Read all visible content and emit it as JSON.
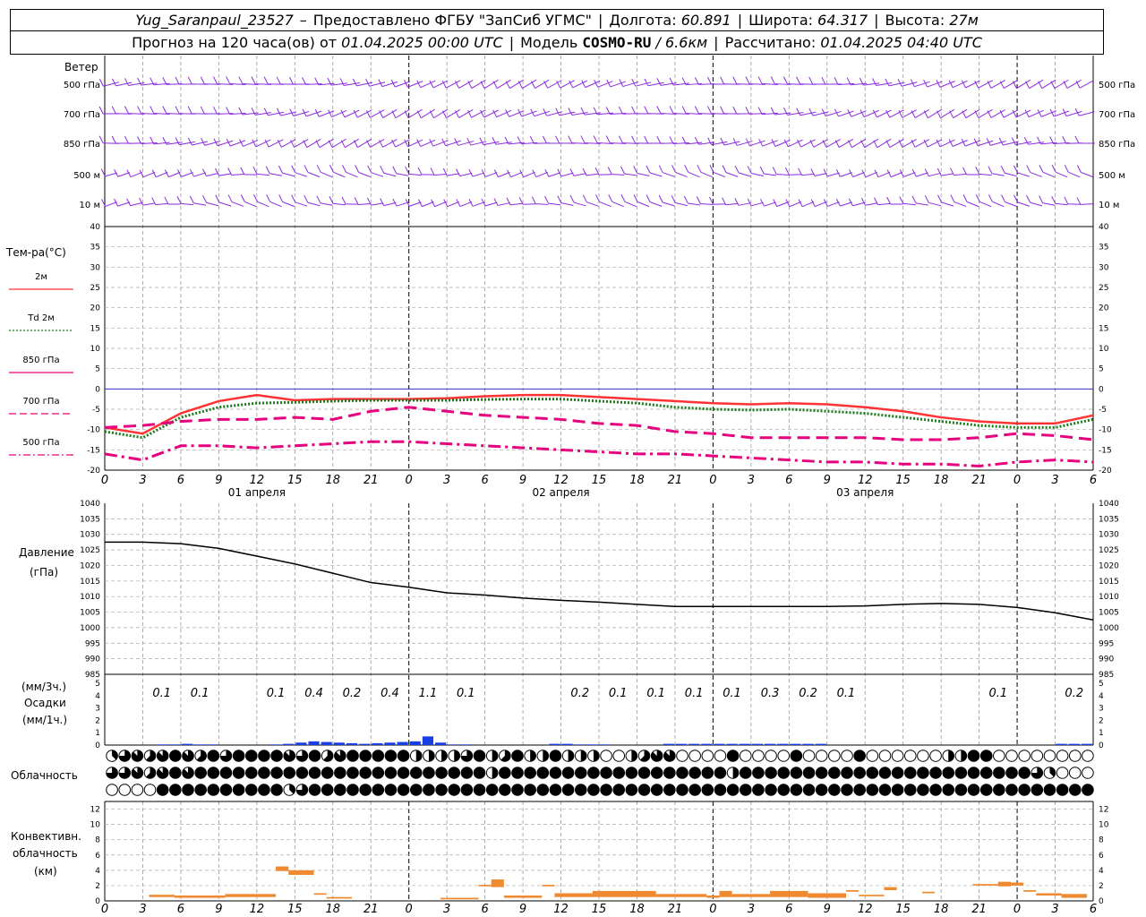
{
  "header": {
    "station": "Yug_Saranpaul_23527",
    "dash": "–",
    "provider": "Предоставлено ФГБУ \"ЗапСиб УГМС\"",
    "lon_label": "Долгота:",
    "lon_value": "60.891",
    "lat_label": "Широта:",
    "lat_value": "64.317",
    "alt_label": "Высота:",
    "alt_value": "27м",
    "forecast_label": "Прогноз на 120 часа(ов) от",
    "forecast_date": "01.04.2025 00:00 UTC",
    "model_label": "Модель",
    "model_name": "COSMO-RU",
    "model_res": "/ 6.6км",
    "calc_label": "Рассчитано:",
    "calc_date": "01.04.2025 04:40 UTC"
  },
  "wind_panel": {
    "title": "Ветер",
    "levels": [
      "500 гПа",
      "700 гПа",
      "850 гПа",
      "500 м",
      "10 м"
    ]
  },
  "temp_panel": {
    "title": "Тем-ра(°C)",
    "legend": [
      {
        "label": "2м",
        "color": "#ff3333",
        "style": "solid"
      },
      {
        "label": "Td 2м",
        "color": "#1a7a1a",
        "style": "dotted"
      },
      {
        "label": "850 гПа",
        "color": "#e6007e",
        "style": "solid"
      },
      {
        "label": "700 гПа",
        "color": "#e6007e",
        "style": "dashed"
      },
      {
        "label": "500 гПа",
        "color": "#e6007e",
        "style": "dashdot"
      }
    ],
    "yticks": [
      "40",
      "35",
      "30",
      "25",
      "20",
      "15",
      "10",
      "5",
      "0",
      "-5",
      "-10",
      "-15",
      "-20"
    ],
    "xticks": [
      "0",
      "3",
      "6",
      "9",
      "12",
      "15",
      "18",
      "21",
      "0",
      "3",
      "6",
      "9",
      "12",
      "15",
      "18",
      "21",
      "0",
      "3",
      "6",
      "9",
      "12",
      "15",
      "18",
      "21",
      "0",
      "3",
      "6"
    ],
    "days": [
      "01 апреля",
      "02 апреля",
      "03 апреля"
    ]
  },
  "pressure_panel": {
    "title1": "Давление",
    "title2": "(гПа)",
    "yticks": [
      "1040",
      "1035",
      "1030",
      "1025",
      "1020",
      "1015",
      "1010",
      "1005",
      "1000",
      "995",
      "990",
      "985"
    ]
  },
  "precip_panel": {
    "title1": "(мм/3ч.)",
    "title2": "Осадки",
    "title3": "(мм/1ч.)",
    "yticks": [
      "5",
      "4",
      "3",
      "2",
      "1",
      "0"
    ],
    "labels": [
      "0.1",
      "0.1",
      "0.1",
      "0.4",
      "0.2",
      "0.4",
      "1.1",
      "0.1",
      "0.2",
      "0.1",
      "0.1",
      "0.1",
      "0.1",
      "0.3",
      "0.2",
      "0.1",
      "0.1",
      "0.2"
    ]
  },
  "cloud_panel": {
    "title": "Облачность"
  },
  "conv_panel": {
    "title1": "Конвективн.",
    "title2": "облачность",
    "title3": "(км)",
    "yticks": [
      "12",
      "10",
      "8",
      "6",
      "4",
      "2",
      "0"
    ]
  },
  "colors": {
    "wind": "#8a2be2",
    "t2m": "#ff3333",
    "td": "#1a7a1a",
    "upper": "#e6007e",
    "pressure": "#000000",
    "precip": "#1a3ee6",
    "conv": "#f08a30",
    "zero": "#3333cc"
  },
  "chart_data": [
    {
      "type": "line",
      "title": "Тем-ра(°C)",
      "x_hours": [
        0,
        3,
        6,
        9,
        12,
        15,
        18,
        21,
        24,
        27,
        30,
        33,
        36,
        39,
        42,
        45,
        48,
        51,
        54,
        57,
        60,
        63,
        66,
        69,
        72,
        75,
        78
      ],
      "ylim": [
        -20,
        40
      ],
      "series": [
        {
          "name": "2м",
          "values": [
            -9.5,
            -11,
            -6,
            -3,
            -1.5,
            -2.8,
            -2.5,
            -2.5,
            -2.5,
            -2.3,
            -1.8,
            -1.5,
            -1.5,
            -2,
            -2.5,
            -3,
            -3.5,
            -3.8,
            -3.5,
            -3.8,
            -4.5,
            -5.5,
            -7,
            -8,
            -8.5,
            -8.5,
            -6.5
          ]
        },
        {
          "name": "Td 2м",
          "values": [
            -10.5,
            -12,
            -7,
            -4.5,
            -3.5,
            -3.3,
            -3,
            -2.8,
            -2.8,
            -2.8,
            -2.6,
            -2.5,
            -2.5,
            -3,
            -3.5,
            -4.5,
            -5,
            -5.2,
            -5,
            -5.5,
            -6,
            -7,
            -8,
            -9,
            -9.5,
            -9.5,
            -7.5
          ]
        },
        {
          "name": "850 гПа",
          "values": [
            -9.5,
            -9,
            -8,
            -7.5,
            -7.5,
            -7,
            -7.5,
            -5.5,
            -4.5,
            -5.5,
            -6.5,
            -7,
            -7.5,
            -8.5,
            -9,
            -10.5,
            -11,
            -12,
            -12,
            -12,
            -12,
            -12.5,
            -12.5,
            -12,
            -11,
            -11.5,
            -12.5
          ]
        },
        {
          "name": "700 гПа",
          "values": [
            -9.5,
            -9,
            -8,
            -7.5,
            -7.5,
            -7,
            -7.5,
            -5.5,
            -4.5,
            -5.5,
            -6.5,
            -7,
            -7.5,
            -8.5,
            -9,
            -10.5,
            -11,
            -12,
            -12,
            -12,
            -12,
            -12.5,
            -12.5,
            -12,
            -11,
            -11.5,
            -12.5
          ]
        },
        {
          "name": "500 гПа",
          "values": [
            -16,
            -17.5,
            -14,
            -14,
            -14.5,
            -14,
            -13.5,
            -13,
            -13,
            -13.5,
            -14,
            -14.5,
            -15,
            -15.5,
            -16,
            -16,
            -16.5,
            -17,
            -17.5,
            -18,
            -18,
            -18.5,
            -18.5,
            -19,
            -18,
            -17.5,
            -18
          ]
        }
      ]
    },
    {
      "type": "line",
      "title": "Давление",
      "x_hours": [
        0,
        3,
        6,
        9,
        12,
        15,
        18,
        21,
        24,
        27,
        30,
        33,
        36,
        39,
        42,
        45,
        48,
        51,
        54,
        57,
        60,
        63,
        66,
        69,
        72,
        75,
        78
      ],
      "ylim": [
        985,
        1040
      ],
      "series": [
        {
          "name": "Давление",
          "values": [
            1027.5,
            1027.5,
            1027,
            1025.5,
            1023,
            1020.5,
            1017.5,
            1014.5,
            1013,
            1011.2,
            1010.5,
            1009.5,
            1008.8,
            1008.2,
            1007.5,
            1006.8,
            1006.8,
            1006.8,
            1006.8,
            1006.8,
            1007,
            1007.5,
            1007.8,
            1007.5,
            1006.5,
            1004.8,
            1002.5
          ]
        }
      ]
    },
    {
      "type": "bar",
      "title": "Осадки",
      "ylim": [
        0,
        5
      ],
      "x_hours": [
        0,
        1,
        2,
        3,
        4,
        5,
        6,
        7,
        8,
        9,
        10,
        11,
        12,
        13,
        14,
        15,
        16,
        17,
        18,
        19,
        20,
        21,
        22,
        23,
        24,
        25,
        26,
        27,
        28,
        29,
        30,
        31,
        32,
        33,
        34,
        35,
        36,
        37,
        38,
        39,
        40,
        41,
        42,
        43,
        44,
        45,
        46,
        47,
        48,
        49,
        50,
        51,
        52,
        53,
        54,
        55,
        56,
        57,
        58,
        59,
        60,
        61,
        62,
        63,
        64,
        65,
        66,
        67,
        68,
        69,
        70,
        71,
        72,
        73,
        74,
        75,
        76,
        77
      ],
      "values": [
        0,
        0,
        0,
        0,
        0.05,
        0.05,
        0.1,
        0.05,
        0.05,
        0,
        0,
        0,
        0,
        0.05,
        0.1,
        0.2,
        0.3,
        0.25,
        0.2,
        0.15,
        0.1,
        0.15,
        0.2,
        0.25,
        0.3,
        0.7,
        0.2,
        0.05,
        0.05,
        0,
        0,
        0,
        0,
        0,
        0,
        0.1,
        0.1,
        0.05,
        0.05,
        0.05,
        0,
        0,
        0,
        0,
        0.1,
        0.1,
        0.1,
        0.1,
        0.1,
        0.1,
        0.1,
        0.1,
        0.1,
        0.1,
        0.1,
        0.1,
        0.1,
        0,
        0,
        0,
        0,
        0,
        0,
        0,
        0,
        0,
        0,
        0,
        0,
        0,
        0,
        0,
        0,
        0,
        0,
        0.1,
        0.1,
        0.1
      ],
      "period_labels": [
        {
          "hour": 4.5,
          "value": "0.1"
        },
        {
          "hour": 7.5,
          "value": "0.1"
        },
        {
          "hour": 13.5,
          "value": "0.1"
        },
        {
          "hour": 16.5,
          "value": "0.4"
        },
        {
          "hour": 19.5,
          "value": "0.2"
        },
        {
          "hour": 22.5,
          "value": "0.4"
        },
        {
          "hour": 25.5,
          "value": "1.1"
        },
        {
          "hour": 28.5,
          "value": "0.1"
        },
        {
          "hour": 37.5,
          "value": "0.2"
        },
        {
          "hour": 40.5,
          "value": "0.1"
        },
        {
          "hour": 43.5,
          "value": "0.1"
        },
        {
          "hour": 46.5,
          "value": "0.1"
        },
        {
          "hour": 49.5,
          "value": "0.1"
        },
        {
          "hour": 52.5,
          "value": "0.3"
        },
        {
          "hour": 55.5,
          "value": "0.2"
        },
        {
          "hour": 58.5,
          "value": "0.1"
        },
        {
          "hour": 70.5,
          "value": "0.1"
        },
        {
          "hour": 76.5,
          "value": "0.2"
        }
      ]
    },
    {
      "type": "bar",
      "title": "Конвективн. облачность",
      "ylim": [
        0,
        13
      ],
      "segments": [
        {
          "from": 3.5,
          "to": 5.5,
          "bottom": 0.5,
          "top": 0.8
        },
        {
          "from": 5.5,
          "to": 9.5,
          "bottom": 0.4,
          "top": 0.7
        },
        {
          "from": 9.5,
          "to": 13.5,
          "bottom": 0.5,
          "top": 0.9
        },
        {
          "from": 13.5,
          "to": 14.5,
          "bottom": 3.9,
          "top": 4.5
        },
        {
          "from": 14.5,
          "to": 16.5,
          "bottom": 3.4,
          "top": 4.0
        },
        {
          "from": 16.5,
          "to": 17.5,
          "bottom": 0.8,
          "top": 1.0
        },
        {
          "from": 17.5,
          "to": 19.5,
          "bottom": 0.3,
          "top": 0.5
        },
        {
          "from": 26.5,
          "to": 29.5,
          "bottom": 0.2,
          "top": 0.4
        },
        {
          "from": 29.5,
          "to": 30.5,
          "bottom": 1.9,
          "top": 2.1
        },
        {
          "from": 30.5,
          "to": 31.5,
          "bottom": 1.8,
          "top": 2.8
        },
        {
          "from": 31.5,
          "to": 34.5,
          "bottom": 0.4,
          "top": 0.7
        },
        {
          "from": 34.5,
          "to": 35.5,
          "bottom": 1.9,
          "top": 2.1
        },
        {
          "from": 35.5,
          "to": 38.5,
          "bottom": 0.5,
          "top": 1.0
        },
        {
          "from": 38.5,
          "to": 43.5,
          "bottom": 0.5,
          "top": 1.3
        },
        {
          "from": 43.5,
          "to": 47.5,
          "bottom": 0.5,
          "top": 0.9
        },
        {
          "from": 47.5,
          "to": 48.5,
          "bottom": 0.4,
          "top": 0.7
        },
        {
          "from": 48.5,
          "to": 49.5,
          "bottom": 0.5,
          "top": 1.3
        },
        {
          "from": 49.5,
          "to": 52.5,
          "bottom": 0.5,
          "top": 0.9
        },
        {
          "from": 52.5,
          "to": 55.5,
          "bottom": 0.5,
          "top": 1.3
        },
        {
          "from": 55.5,
          "to": 58.5,
          "bottom": 0.4,
          "top": 1.0
        },
        {
          "from": 58.5,
          "to": 59.5,
          "bottom": 1.2,
          "top": 1.4
        },
        {
          "from": 59.5,
          "to": 61.5,
          "bottom": 0.6,
          "top": 0.8
        },
        {
          "from": 61.5,
          "to": 62.5,
          "bottom": 1.4,
          "top": 1.8
        },
        {
          "from": 64.5,
          "to": 65.5,
          "bottom": 1.0,
          "top": 1.2
        },
        {
          "from": 68.5,
          "to": 70.5,
          "bottom": 2.0,
          "top": 2.2
        },
        {
          "from": 70.5,
          "to": 71.5,
          "bottom": 1.9,
          "top": 2.5
        },
        {
          "from": 71.5,
          "to": 72.5,
          "bottom": 2.0,
          "top": 2.4
        },
        {
          "from": 72.5,
          "to": 73.5,
          "bottom": 1.2,
          "top": 1.4
        },
        {
          "from": 73.5,
          "to": 75.5,
          "bottom": 0.7,
          "top": 1.0
        },
        {
          "from": 75.5,
          "to": 77.5,
          "bottom": 0.4,
          "top": 0.9
        }
      ]
    },
    {
      "type": "table",
      "title": "Облачность",
      "rows": 3,
      "hours_per_cell": 3,
      "cover_eighths": [
        [
          3,
          6,
          7,
          5,
          7,
          8,
          7,
          5,
          8,
          6,
          8,
          8,
          8,
          8,
          7,
          6,
          8,
          5,
          7,
          8,
          8,
          8,
          8,
          8,
          4,
          4,
          4,
          4,
          6,
          8,
          4,
          5,
          8,
          4,
          4,
          8,
          4,
          4,
          4,
          0,
          0,
          4,
          5,
          7,
          7,
          0,
          0,
          0,
          0,
          8,
          0,
          0,
          0,
          0,
          8,
          0,
          0,
          0,
          0,
          8,
          0,
          0,
          0,
          0,
          0,
          0,
          4,
          4,
          8,
          8,
          0,
          0,
          0,
          0,
          0,
          0,
          0,
          0
        ],
        [
          6,
          6,
          7,
          5,
          7,
          8,
          7,
          8,
          8,
          8,
          8,
          8,
          8,
          8,
          8,
          8,
          8,
          8,
          8,
          8,
          8,
          8,
          8,
          8,
          8,
          8,
          8,
          8,
          8,
          8,
          4,
          8,
          8,
          8,
          8,
          8,
          8,
          8,
          8,
          8,
          8,
          8,
          8,
          8,
          8,
          8,
          8,
          8,
          8,
          4,
          8,
          8,
          8,
          8,
          8,
          8,
          8,
          8,
          8,
          8,
          8,
          8,
          8,
          8,
          8,
          8,
          8,
          8,
          8,
          8,
          8,
          8,
          8,
          6,
          3,
          0,
          0,
          0
        ],
        [
          0,
          0,
          0,
          0,
          8,
          8,
          8,
          8,
          8,
          8,
          8,
          8,
          8,
          8,
          3,
          6,
          8,
          8,
          8,
          8,
          8,
          8,
          8,
          8,
          8,
          8,
          8,
          8,
          8,
          8,
          8,
          8,
          8,
          8,
          8,
          8,
          8,
          8,
          8,
          8,
          8,
          8,
          8,
          8,
          8,
          8,
          8,
          8,
          8,
          8,
          8,
          8,
          8,
          8,
          8,
          8,
          8,
          8,
          8,
          8,
          8,
          8,
          8,
          8,
          8,
          8,
          8,
          8,
          8,
          8,
          8,
          8,
          8,
          8,
          8,
          8,
          8,
          8
        ]
      ]
    }
  ]
}
